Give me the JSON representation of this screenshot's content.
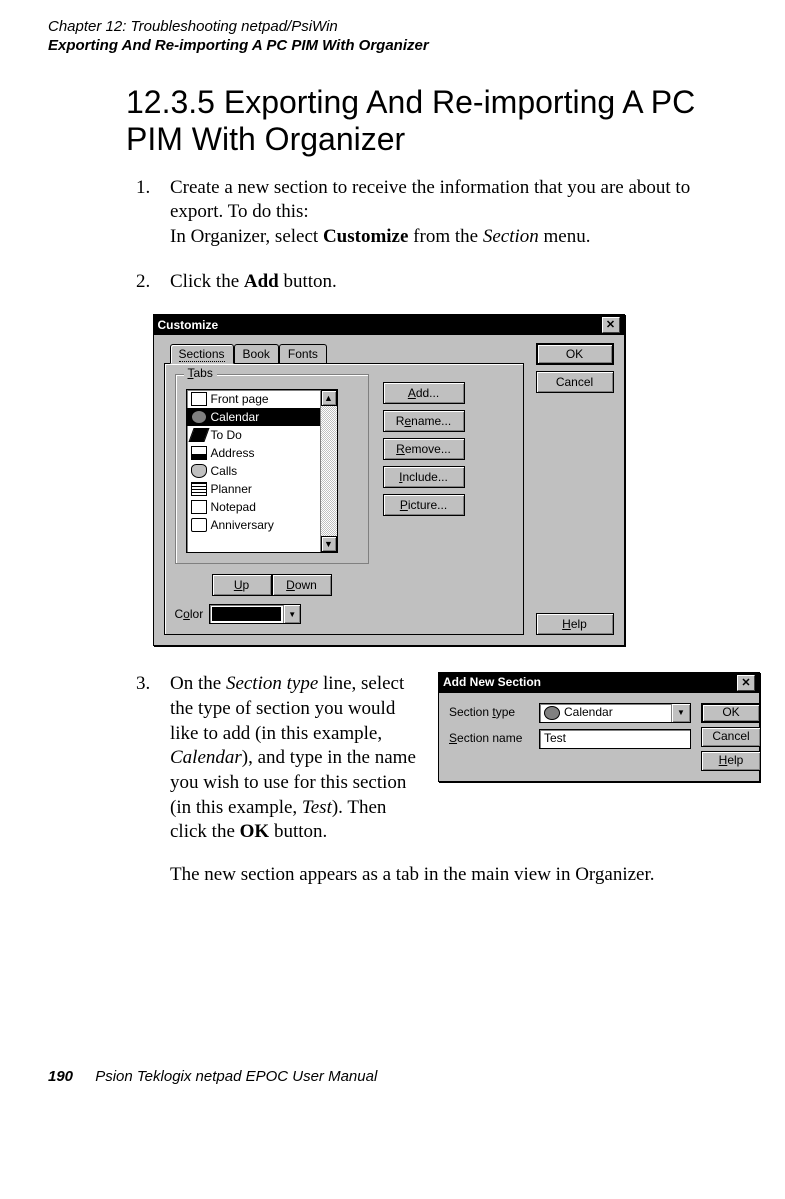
{
  "header": {
    "chapter": "Chapter 12:  Troubleshooting netpad/PsiWin",
    "section": "Exporting And Re-importing A PC PIM With Organizer"
  },
  "title": "12.3.5   Exporting And Re-importing A PC PIM With Organizer",
  "step1": {
    "num": "1.",
    "t1": "Create a new section to receive the information that you are about to export. To do this:",
    "t2a": "In Organizer, select ",
    "t2b": "Customize",
    "t2c": " from the ",
    "t2d": "Section",
    "t2e": " menu."
  },
  "step2": {
    "num": "2.",
    "t1": "Click the ",
    "t2": "Add",
    "t3": " button."
  },
  "dialog1": {
    "title": "Customize",
    "tabs": {
      "sections": "Sections",
      "book": "Book",
      "fonts": "Fonts"
    },
    "tabs_label": "Tabs",
    "tabs_accel": "T",
    "list": {
      "front": "Front page",
      "calendar": "Calendar",
      "todo": "To Do",
      "address": "Address",
      "calls": "Calls",
      "planner": "Planner",
      "notepad": "Notepad",
      "anniversary": "Anniversary"
    },
    "btns": {
      "add": "Add...",
      "add_accel": "A",
      "rename": "Rename...",
      "rename_accel": "e",
      "remove": "Remove...",
      "remove_accel": "R",
      "include": "Include...",
      "include_accel": "I",
      "picture": "Picture...",
      "picture_accel": "P",
      "up": "Up",
      "up_accel": "U",
      "down": "Down",
      "down_accel": "D"
    },
    "color_label": "Color",
    "color_accel": "o",
    "ok": "OK",
    "cancel": "Cancel",
    "help": "Help",
    "help_accel": "H"
  },
  "step3": {
    "num": "3.",
    "t1": "On the ",
    "t2": "Section type",
    "t3": " line, select the type of section you would like to add (in this example, ",
    "t4": "Calendar",
    "t5": "), and type in the name you wish to use for this section (in this example, ",
    "t6": "Test",
    "t7": "). Then click the ",
    "t8": "OK",
    "t9": " button.",
    "after": "The new section appears as a tab in the main view in Organizer."
  },
  "dialog2": {
    "title": "Add New Section",
    "type_label": "Section type",
    "type_accel": "t",
    "type_value": "Calendar",
    "name_label": "Section name",
    "name_accel": "S",
    "name_value": "Test",
    "ok": "OK",
    "cancel": "Cancel",
    "help": "Help",
    "help_accel": "H"
  },
  "footer": {
    "page": "190",
    "manual": "Psion Teklogix netpad EPOC User Manual"
  }
}
